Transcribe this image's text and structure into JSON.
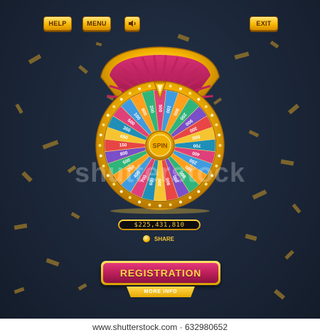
{
  "header": {
    "help_label": "HELP",
    "menu_label": "MENU",
    "sound_icon": "speaker-icon",
    "exit_label": "EXIT"
  },
  "wheel": {
    "spin_label": "SPIN",
    "segments": [
      "500",
      "100",
      "800",
      "200",
      "900",
      "300",
      "600",
      "700",
      "400",
      "250",
      "100",
      "800",
      "200",
      "900",
      "300",
      "600",
      "700",
      "400",
      "250",
      "500",
      "800",
      "150",
      "650",
      "350",
      "500",
      "100",
      "800",
      "200"
    ],
    "segment_colors": [
      "#e0407a",
      "#3f9be0",
      "#ff9f1c",
      "#2fb57a",
      "#7b4fc9",
      "#e84545",
      "#f6c431",
      "#1f8fb8",
      "#e0407a",
      "#3f9be0",
      "#ff9f1c",
      "#2fb57a",
      "#7b4fc9",
      "#e84545",
      "#f6c431",
      "#1f8fb8",
      "#e0407a",
      "#3f9be0",
      "#ff9f1c",
      "#2fb57a",
      "#7b4fc9",
      "#e84545",
      "#f6c431",
      "#1f8fb8",
      "#e0407a",
      "#3f9be0",
      "#ff9f1c",
      "#2fb57a"
    ]
  },
  "jackpot": {
    "value": "$225,431,810"
  },
  "share": {
    "label": "SHARE"
  },
  "registration": {
    "label": "REGISTRATION",
    "more_info_label": "MORE INFO"
  },
  "watermark": {
    "text": "shutterstock"
  },
  "footer": {
    "text": "www.shutterstock.com · 632980652"
  },
  "colors": {
    "background": "#1b2638",
    "gold": "#f5b400",
    "magenta": "#b81d57"
  }
}
